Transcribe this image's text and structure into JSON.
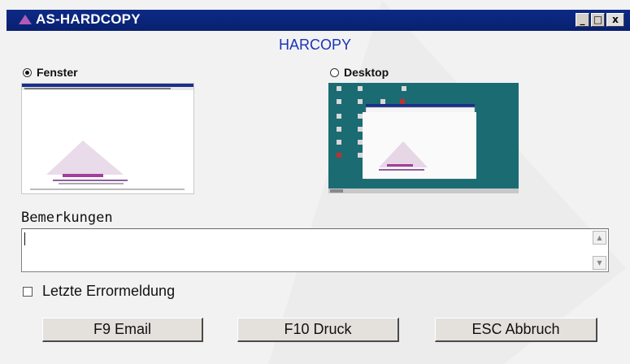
{
  "window": {
    "title": "AS-HARDCOPY",
    "controls": {
      "minimize": "_",
      "maximize": "□",
      "close": "x"
    }
  },
  "heading": "HARCOPY",
  "options": {
    "fenster": {
      "label": "Fenster",
      "selected": true
    },
    "desktop": {
      "label": "Desktop",
      "selected": false
    }
  },
  "remarks": {
    "label": "Bemerkungen",
    "value": ""
  },
  "error_checkbox": {
    "label": "Letzte Errormeldung",
    "checked": false
  },
  "buttons": {
    "email": "F9 Email",
    "print": "F10 Druck",
    "cancel": "ESC Abbruch"
  },
  "colors": {
    "titlebar": "#0c2a86",
    "heading": "#1a33b8",
    "desktop_bg": "#1b6b73",
    "logo": "#8a2a8a"
  },
  "icons": {
    "title": "triangle-logo-icon",
    "scroll_up": "arrow-up-icon",
    "scroll_down": "arrow-down-icon"
  }
}
